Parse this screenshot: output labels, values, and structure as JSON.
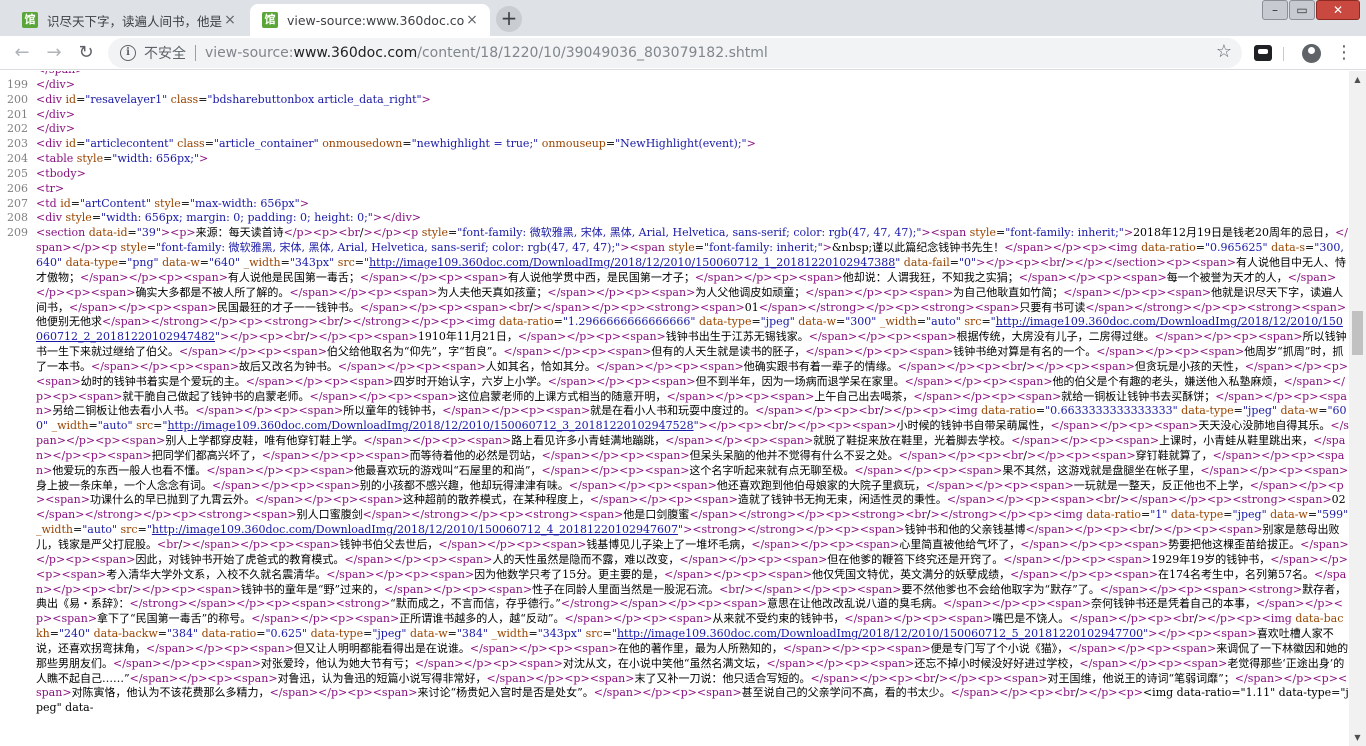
{
  "tabs": [
    {
      "title": "识尽天下字，读遍人间书，他是民",
      "favicon": "馆",
      "active": false
    },
    {
      "title": "view-source:www.360doc.com",
      "favicon": "馆",
      "active": true
    }
  ],
  "window_controls": {
    "minimize": "–",
    "maximize": "▭",
    "close": "✕"
  },
  "toolbar": {
    "security_label": "不安全",
    "url_scheme": "view-source:",
    "url_host": "www.360doc.com",
    "url_path": "/content/18/1220/10/39049036_803079182.shtml"
  },
  "icons": {
    "back": "←",
    "forward": "→",
    "reload": "↻",
    "info": "i",
    "star": "☆",
    "menu": "⋮",
    "new_tab": "+",
    "tab_close": "×",
    "scroll_up": "▲",
    "scroll_down": "▼"
  },
  "source_lines": [
    {
      "n": "",
      "html": "&lt;/span&gt;"
    },
    {
      "n": "199",
      "html": "&lt;/div&gt;"
    },
    {
      "n": "200",
      "html": "&lt;div id=\"resavelayer1\" class=\"bdsharebuttonbox article_data_right\"&gt;"
    },
    {
      "n": "201",
      "html": "&lt;/div&gt;"
    },
    {
      "n": "202",
      "html": "&lt;/div&gt;"
    },
    {
      "n": "203",
      "html": "&lt;div id=\"articlecontent\" class=\"article_container\" onmousedown=\"newhighlight = true;\" onmouseup=\"NewHighlight(event);\"&gt;"
    },
    {
      "n": "204",
      "html": "&lt;table style=\"width: 656px;\"&gt;"
    },
    {
      "n": "205",
      "html": "&lt;tbody&gt;"
    },
    {
      "n": "206",
      "html": "&lt;tr&gt;"
    },
    {
      "n": "207",
      "html": "&lt;td id=\"artContent\" style=\"max-width: 656px\"&gt;"
    },
    {
      "n": "208",
      "html": "&lt;div style=\"width: 656px; margin: 0; padding: 0; height: 0;\"&gt;&lt;/div&gt;"
    },
    {
      "n": "209",
      "html": "&lt;section data-id=\"39\"&gt;&lt;p&gt;来源：每天读首诗&lt;/p&gt;&lt;p&gt;&lt;br/&gt;&lt;/p&gt;&lt;p style=\"font-family: 微软雅黑, 宋体, 黑体, Arial, Helvetica, sans-serif; color: rgb(47, 47, 47);\"&gt;&lt;span style=\"font-family: inherit;\"&gt;2018年12月19日是钱老20周年的忌日，&lt;/span&gt;&lt;/p&gt;&lt;p style=\"font-family: 微软雅黑, 宋体, 黑体, Arial, Helvetica, sans-serif; color: rgb(47, 47, 47);\"&gt;&lt;span style=\"font-family: inherit;\"&gt;&amp;nbsp;谨以此篇纪念钱钟书先生！&lt;/span&gt;&lt;/p&gt;&lt;p&gt;&lt;img data-ratio=\"0.965625\" data-s=\"300,640\" data-type=\"png\" data-w=\"640\" _width=\"343px\" src=\"http://image109.360doc.com/DownloadImg/2018/12/2010/150060712_1_20181220102947388\" data-fail=\"0\"&gt;&lt;/p&gt;&lt;p&gt;&lt;br/&gt;&lt;/p&gt;&lt;/section&gt;&lt;p&gt;&lt;span&gt;有人说他目中无人、恃才傲物；&lt;/span&gt;&lt;/p&gt;&lt;p&gt;&lt;span&gt;有人说他是民国第一毒舌；&lt;/span&gt;&lt;/p&gt;&lt;p&gt;&lt;span&gt;有人说他学贯中西，是民国第一才子；&lt;/span&gt;&lt;/p&gt;&lt;p&gt;&lt;span&gt;他却说：人谓我狂，不知我之实狷；&lt;/span&gt;&lt;/p&gt;&lt;p&gt;&lt;span&gt;每一个被誉为天才的人，&lt;/span&gt;&lt;/p&gt;&lt;p&gt;&lt;span&gt;确实大多都是不被人所了解的。&lt;/span&gt;&lt;/p&gt;&lt;p&gt;&lt;span&gt;为人夫他天真如孩童；&lt;/span&gt;&lt;/p&gt;&lt;p&gt;&lt;span&gt;为人父他调皮如顽童；&lt;/span&gt;&lt;/p&gt;&lt;p&gt;&lt;span&gt;为自己他耿直如竹简；&lt;/span&gt;&lt;/p&gt;&lt;p&gt;&lt;span&gt;他就是识尽天下字，读遍人间书，&lt;/span&gt;&lt;/p&gt;&lt;p&gt;&lt;span&gt;民国最狂的才子一一钱钟书。&lt;/span&gt;&lt;/p&gt;&lt;p&gt;&lt;span&gt;&lt;br/&gt;&lt;/span&gt;&lt;/p&gt;&lt;p&gt;&lt;strong&gt;&lt;span&gt;01&lt;/span&gt;&lt;/strong&gt;&lt;/p&gt;&lt;p&gt;&lt;strong&gt;&lt;span&gt;只要有书可读&lt;/span&gt;&lt;/strong&gt;&lt;/p&gt;&lt;p&gt;&lt;strong&gt;&lt;span&gt;他便别无他求&lt;/span&gt;&lt;/strong&gt;&lt;/p&gt;&lt;p&gt;&lt;strong&gt;&lt;br/&gt;&lt;/strong&gt;&lt;/p&gt;&lt;p&gt;&lt;img data-ratio=\"1.2966666666666666\" data-type=\"jpeg\" data-w=\"300\" _width=\"auto\" src=\"http://image109.360doc.com/DownloadImg/2018/12/2010/150060712_2_20181220102947482\"&gt;&lt;/p&gt;&lt;p&gt;&lt;br/&gt;&lt;/p&gt;&lt;p&gt;&lt;span&gt;1910年11月21日，&lt;/span&gt;&lt;/p&gt;&lt;p&gt;&lt;span&gt;钱钟书出生于江苏无锡钱家。&lt;/span&gt;&lt;/p&gt;&lt;p&gt;&lt;span&gt;根据传统，大房没有儿子，二房得过继。&lt;/span&gt;&lt;/p&gt;&lt;p&gt;&lt;span&gt;所以钱钟书一生下来就过继给了伯父。&lt;/span&gt;&lt;/p&gt;&lt;p&gt;&lt;span&gt;伯父给他取名为“仰先”，字“哲良”。&lt;/span&gt;&lt;/p&gt;&lt;p&gt;&lt;span&gt;但有的人天生就是读书的胚子，&lt;/span&gt;&lt;/p&gt;&lt;p&gt;&lt;span&gt;钱钟书绝对算是有名的一个。&lt;/span&gt;&lt;/p&gt;&lt;p&gt;&lt;span&gt;他周岁“抓周”时，抓了一本书。&lt;/span&gt;&lt;/p&gt;&lt;p&gt;&lt;span&gt;故后又改名为钟书。&lt;/span&gt;&lt;/p&gt;&lt;p&gt;&lt;span&gt;人如其名，恰如其分。&lt;/span&gt;&lt;/p&gt;&lt;p&gt;&lt;span&gt;他确实跟书有着一辈子的情缘。&lt;/span&gt;&lt;/p&gt;&lt;p&gt;&lt;br/&gt;&lt;/p&gt;&lt;p&gt;&lt;span&gt;但贪玩是小孩的天性，&lt;/span&gt;&lt;/p&gt;&lt;p&gt;&lt;span&gt;幼时的钱钟书着实是个爱玩的主。&lt;/span&gt;&lt;/p&gt;&lt;p&gt;&lt;span&gt;四岁时开始认字，六岁上小学。&lt;/span&gt;&lt;/p&gt;&lt;p&gt;&lt;span&gt;但不到半年，因为一场病而退学呆在家里。&lt;/span&gt;&lt;/p&gt;&lt;p&gt;&lt;span&gt;他的伯父是个有趣的老头，嫌送他入私塾麻烦，&lt;/span&gt;&lt;/p&gt;&lt;p&gt;&lt;span&gt;就干脆自己做起了钱钟书的启蒙老师。&lt;/span&gt;&lt;/p&gt;&lt;p&gt;&lt;span&gt;这位启蒙老师的上课方式相当的随意开明，&lt;/span&gt;&lt;/p&gt;&lt;p&gt;&lt;span&gt;上午自己出去喝茶，&lt;/span&gt;&lt;/p&gt;&lt;p&gt;&lt;span&gt;就给一铜板让钱钟书去买酥饼；&lt;/span&gt;&lt;/p&gt;&lt;p&gt;&lt;span&gt;另给二铜板让他去看小人书。&lt;/span&gt;&lt;/p&gt;&lt;p&gt;&lt;span&gt;所以童年的钱钟书，&lt;/span&gt;&lt;/p&gt;&lt;p&gt;&lt;span&gt;就是在看小人书和玩耍中度过的。&lt;/span&gt;&lt;/p&gt;&lt;p&gt;&lt;br/&gt;&lt;/p&gt;&lt;p&gt;&lt;img data-ratio=\"0.6633333333333333\" data-type=\"jpeg\" data-w=\"600\" _width=\"auto\" src=\"http://image109.360doc.com/DownloadImg/2018/12/2010/150060712_3_20181220102947528\"&gt;&lt;/p&gt;&lt;p&gt;&lt;br/&gt;&lt;/p&gt;&lt;p&gt;&lt;span&gt;小时候的钱钟书自带呆萌属性，&lt;/span&gt;&lt;/p&gt;&lt;p&gt;&lt;span&gt;天天没心没肺地自得其乐。&lt;/span&gt;&lt;/p&gt;&lt;p&gt;&lt;span&gt;别人上学都穿皮鞋，唯有他穿钉鞋上学。&lt;/span&gt;&lt;/p&gt;&lt;p&gt;&lt;span&gt;路上看见许多小青蛙满地蹦跳，&lt;/span&gt;&lt;/p&gt;&lt;p&gt;&lt;span&gt;就脱了鞋捉来放在鞋里，光着脚去学校。&lt;/span&gt;&lt;/p&gt;&lt;p&gt;&lt;span&gt;上课时，小青蛙从鞋里跳出来，&lt;/span&gt;&lt;/p&gt;&lt;p&gt;&lt;span&gt;把同学们都高兴坏了，&lt;/span&gt;&lt;/p&gt;&lt;p&gt;&lt;span&gt;而等待着他的必然是罚站，&lt;/span&gt;&lt;/p&gt;&lt;p&gt;&lt;span&gt;但呆头呆脑的他并不觉得有什么不妥之处。&lt;/span&gt;&lt;/p&gt;&lt;p&gt;&lt;br/&gt;&lt;/p&gt;&lt;p&gt;&lt;span&gt;穿钉鞋就算了，&lt;/span&gt;&lt;/p&gt;&lt;p&gt;&lt;span&gt;他爱玩的东西一般人也看不懂。&lt;/span&gt;&lt;/p&gt;&lt;p&gt;&lt;span&gt;他最喜欢玩的游戏叫“石屋里的和尚”，&lt;/span&gt;&lt;/p&gt;&lt;p&gt;&lt;span&gt;这个名字听起来就有点无聊至极。&lt;/span&gt;&lt;/p&gt;&lt;p&gt;&lt;span&gt;果不其然，这游戏就是盘腿坐在帐子里，&lt;/span&gt;&lt;/p&gt;&lt;p&gt;&lt;span&gt;身上披一条床单，一个人念念有词。&lt;/span&gt;&lt;/p&gt;&lt;p&gt;&lt;span&gt;别的小孩都不感兴趣，他却玩得津津有味。&lt;/span&gt;&lt;/p&gt;&lt;p&gt;&lt;span&gt;他还喜欢跑到他伯母娘家的大院子里疯玩，&lt;/span&gt;&lt;/p&gt;&lt;p&gt;&lt;span&gt;一玩就是一整天，反正他也不上学，&lt;/span&gt;&lt;/p&gt;&lt;p&gt;&lt;span&gt;功课什么的早已抛到了九霄云外。&lt;/span&gt;&lt;/p&gt;&lt;p&gt;&lt;span&gt;这种超前的散养模式，在某种程度上，&lt;/span&gt;&lt;/p&gt;&lt;p&gt;&lt;span&gt;造就了钱钟书无拘无束，闲适性灵的秉性。&lt;/span&gt;&lt;/p&gt;&lt;p&gt;&lt;span&gt;&lt;br/&gt;&lt;/span&gt;&lt;/p&gt;&lt;p&gt;&lt;strong&gt;&lt;span&gt;02&lt;/span&gt;&lt;/strong&gt;&lt;/p&gt;&lt;p&gt;&lt;strong&gt;&lt;span&gt;别人口蜜腹剑&lt;/span&gt;&lt;/strong&gt;&lt;/p&gt;&lt;p&gt;&lt;strong&gt;&lt;span&gt;他是口剑腹蜜&lt;/span&gt;&lt;/strong&gt;&lt;/p&gt;&lt;p&gt;&lt;strong&gt;&lt;br/&gt;&lt;/strong&gt;&lt;/p&gt;&lt;p&gt;&lt;img data-ratio=\"1\" data-type=\"jpeg\" data-w=\"599\" _width=\"auto\" src=\"http://image109.360doc.com/DownloadImg/2018/12/2010/150060712_4_20181220102947607\"&gt;&lt;strong&gt;&lt;/strong&gt;&lt;/p&gt;&lt;p&gt;&lt;span&gt;钱钟书和他的父亲钱基博&lt;/span&gt;&lt;/p&gt;&lt;p&gt;&lt;br/&gt;&lt;/p&gt;&lt;p&gt;&lt;span&gt;别家是慈母出败儿，钱家是严父打屁股。&lt;br/&gt;&lt;/span&gt;&lt;/p&gt;&lt;p&gt;&lt;span&gt;钱钟书伯父去世后，&lt;/span&gt;&lt;/p&gt;&lt;p&gt;&lt;span&gt;钱基博见儿子染上了一堆坏毛病，&lt;/span&gt;&lt;/p&gt;&lt;p&gt;&lt;span&gt;心里简直被他给气坏了，&lt;/span&gt;&lt;/p&gt;&lt;p&gt;&lt;span&gt;势要把他这棵歪苗给拔正。&lt;/span&gt;&lt;/p&gt;&lt;p&gt;&lt;span&gt;因此，对钱钟书开始了虎爸式的教育模式。&lt;/span&gt;&lt;/p&gt;&lt;p&gt;&lt;span&gt;人的天性虽然是隐而不露，难以改变，&lt;/span&gt;&lt;/p&gt;&lt;p&gt;&lt;span&gt;但在他爹的鞭笞下终究还是开窍了。&lt;/span&gt;&lt;/p&gt;&lt;p&gt;&lt;span&gt;1929年19岁的钱钟书，&lt;/span&gt;&lt;/p&gt;&lt;p&gt;&lt;span&gt;考入清华大学外文系，入校不久就名震清华。&lt;/span&gt;&lt;/p&gt;&lt;p&gt;&lt;span&gt;因为他数学只考了15分。更主要的是，&lt;/span&gt;&lt;/p&gt;&lt;p&gt;&lt;span&gt;他仅凭国文特优，英文满分的妖孽成绩，&lt;/span&gt;&lt;/p&gt;&lt;p&gt;&lt;span&gt;在174名考生中，名列第57名。&lt;/span&gt;&lt;/p&gt;&lt;p&gt;&lt;br/&gt;&lt;/p&gt;&lt;p&gt;&lt;span&gt;钱钟书的童年是“野”过来的，&lt;/span&gt;&lt;/p&gt;&lt;p&gt;&lt;span&gt;性子在同龄人里面当然是一股泥石流。&lt;br/&gt;&lt;/span&gt;&lt;/p&gt;&lt;p&gt;&lt;span&gt;要不然他爹也不会给他取字为“默存”了。&lt;/span&gt;&lt;/p&gt;&lt;p&gt;&lt;span&gt;&lt;strong&gt;默存者，典出《易・系辞》：&lt;/strong&gt;&lt;/span&gt;&lt;/p&gt;&lt;p&gt;&lt;span&gt;&lt;strong&gt;“默而成之，不言而信，存乎德行。”&lt;/strong&gt;&lt;/span&gt;&lt;/p&gt;&lt;p&gt;&lt;span&gt;意思在让他改改乱说八道的臭毛病。&lt;/span&gt;&lt;/p&gt;&lt;p&gt;&lt;span&gt;奈何钱钟书还是凭着自己的本事，&lt;/span&gt;&lt;/p&gt;&lt;p&gt;&lt;span&gt;拿下了“民国第一毒舌”的称号。&lt;/span&gt;&lt;/p&gt;&lt;p&gt;&lt;span&gt;正所谓谁书越多的人，越“反动”。&lt;/span&gt;&lt;/p&gt;&lt;p&gt;&lt;span&gt;从来就不受约束的钱钟书，&lt;/span&gt;&lt;/p&gt;&lt;p&gt;&lt;span&gt;嘴巴是不饶人。&lt;/span&gt;&lt;/p&gt;&lt;p&gt;&lt;br/&gt;&lt;/p&gt;&lt;p&gt;&lt;img data-backh=\"240\" data-backw=\"384\" data-ratio=\"0.625\" data-type=\"jpeg\" data-w=\"384\" _width=\"343px\" src=\"http://image109.360doc.com/DownloadImg/2018/12/2010/150060712_5_20181220102947700\"&gt;&lt;/p&gt;&lt;p&gt;&lt;span&gt;喜欢吐槽人家不说，还喜欢拐弯抹角，&lt;/span&gt;&lt;/p&gt;&lt;p&gt;&lt;span&gt;但又让人明明都能看得出是在说谁。&lt;/span&gt;&lt;/p&gt;&lt;p&gt;&lt;span&gt;在他的著作里，最为人所熟知的，&lt;/span&gt;&lt;/p&gt;&lt;p&gt;&lt;span&gt;便是专门写了个小说《猫》，&lt;/span&gt;&lt;/p&gt;&lt;p&gt;&lt;span&gt;来调侃了一下林徽因和她的那些男朋友们。&lt;/span&gt;&lt;/p&gt;&lt;p&gt;&lt;span&gt;对张爱玲，他认为她大节有亏；&lt;/span&gt;&lt;/p&gt;&lt;p&gt;&lt;span&gt;对沈从文，在小说中笑他“虽然名满文坛，&lt;/span&gt;&lt;/p&gt;&lt;p&gt;&lt;span&gt;还忘不掉小时候没好好进过学校，&lt;/span&gt;&lt;/p&gt;&lt;p&gt;&lt;span&gt;老觉得那些‘正途出身’的人瞧不起自己……”&lt;/span&gt;&lt;/p&gt;&lt;p&gt;&lt;span&gt;对鲁迅，认为鲁迅的短篇小说写得非常好，&lt;/span&gt;&lt;/p&gt;&lt;p&gt;&lt;span&gt;末了又补一刀说：他只适合写短的。&lt;/span&gt;&lt;/p&gt;&lt;p&gt;&lt;br/&gt;&lt;/p&gt;&lt;p&gt;&lt;span&gt;对王国维，他说王的诗词“笔弱词靡”；&lt;/span&gt;&lt;/p&gt;&lt;p&gt;&lt;span&gt;对陈寅恪，他认为不该花费那么多精力，&lt;/span&gt;&lt;/p&gt;&lt;p&gt;&lt;span&gt;来讨论“杨贵妃入宫时是否是处女”。&lt;/span&gt;&lt;/p&gt;&lt;p&gt;&lt;span&gt;甚至说自己的父亲学问不高，看的书太少。&lt;/span&gt;&lt;/p&gt;&lt;p&gt;&lt;br/&gt;&lt;/p&gt;&lt;p&gt;&lt;img data-ratio=\"1.11\" data-type=\"jpeg\" data-"
    }
  ]
}
